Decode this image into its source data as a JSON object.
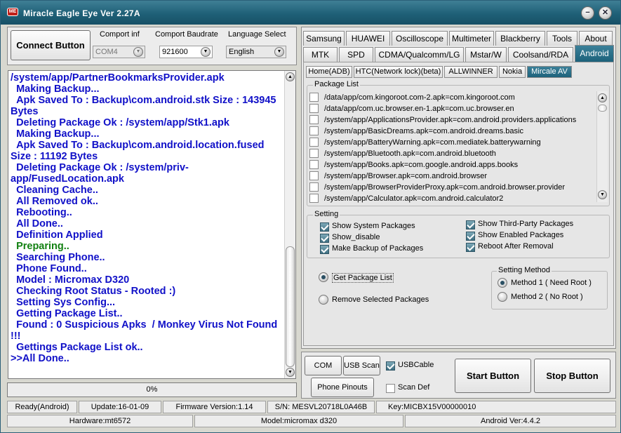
{
  "window": {
    "title": "Miracle Eagle Eye  Ver 2.27A",
    "icon_text": "ME",
    "minimize_icon": "−",
    "close_icon": "✕"
  },
  "connect": {
    "button": "Connect Button",
    "port_label": "Comport inf",
    "port_value": "COM4",
    "baud_label": "Comport Baudrate",
    "baud_value": "921600",
    "lang_label": "Language Select",
    "lang_value": "English"
  },
  "log": {
    "lines": [
      {
        "text": "/system/app/PartnerBookmarksProvider.apk",
        "color": "#1010c8"
      },
      {
        "text": "  Making Backup...",
        "color": "#1010c8"
      },
      {
        "text": "  Apk Saved To : Backup\\com.android.stk Size : 143945 Bytes",
        "color": "#1010c8"
      },
      {
        "text": "  Deleting Package Ok : /system/app/Stk1.apk",
        "color": "#1010c8"
      },
      {
        "text": "  Making Backup...",
        "color": "#1010c8"
      },
      {
        "text": "  Apk Saved To : Backup\\com.android.location.fused Size : 11192 Bytes",
        "color": "#1010c8"
      },
      {
        "text": "  Deleting Package Ok : /system/priv-app/FusedLocation.apk",
        "color": "#1010c8"
      },
      {
        "text": "  Cleaning Cache..",
        "color": "#1010c8"
      },
      {
        "text": "  All Removed ok..",
        "color": "#1010c8"
      },
      {
        "text": "  Rebooting..",
        "color": "#1010c8"
      },
      {
        "text": "  All Done..",
        "color": "#1010c8"
      },
      {
        "text": "  Definition Applied",
        "color": "#1010c8"
      },
      {
        "text": "  Preparing..",
        "color": "#118011"
      },
      {
        "text": "  Searching Phone..",
        "color": "#1010c8"
      },
      {
        "text": "  Phone Found..",
        "color": "#1010c8"
      },
      {
        "text": "  Model : Micromax D320",
        "color": "#1010c8"
      },
      {
        "text": "  Checking Root Status - Rooted :)",
        "color": "#1010c8"
      },
      {
        "text": "  Setting Sys Config...",
        "color": "#1010c8"
      },
      {
        "text": "  Getting Package List..",
        "color": "#1010c8"
      },
      {
        "text": "  Found : 0 Suspicious Apks  / Monkey Virus Not Found !!!",
        "color": "#1010c8"
      },
      {
        "text": "  Gettings Package List ok..",
        "color": "#1010c8"
      },
      {
        "text": ">>All Done..",
        "color": "#1010c8"
      }
    ]
  },
  "progress": {
    "value": 0,
    "label": "0%"
  },
  "tabs_row1": [
    "Samsung",
    "HUAWEI",
    "Oscilloscope",
    "Multimeter",
    "Blackberry",
    "Tools",
    "About"
  ],
  "tabs_row2": [
    "MTK",
    "SPD",
    "CDMA/Qualcomm/LG",
    "Mstar/W",
    "Coolsand/RDA",
    "Android"
  ],
  "active_tab": "Android",
  "subtabs": [
    "Home(ADB)",
    "HTC(Network lock)(beta)",
    "ALLWINNER",
    "Nokia",
    "Mircale AV"
  ],
  "active_subtab": "Mircale AV",
  "package_list": {
    "title": "Package List",
    "items": [
      "/data/app/com.kingoroot.com-2.apk=com.kingoroot.com",
      "/data/app/com.uc.browser.en-1.apk=com.uc.browser.en",
      "/system/app/ApplicationsProvider.apk=com.android.providers.applications",
      "/system/app/BasicDreams.apk=com.android.dreams.basic",
      "/system/app/BatteryWarning.apk=com.mediatek.batterywarning",
      "/system/app/Bluetooth.apk=com.android.bluetooth",
      "/system/app/Books.apk=com.google.android.apps.books",
      "/system/app/Browser.apk=com.android.browser",
      "/system/app/BrowserProviderProxy.apk=com.android.browser.provider",
      "/system/app/Calculator.apk=com.android.calculator2"
    ]
  },
  "setting": {
    "title": "Setting",
    "options": [
      {
        "label": "Show System Packages",
        "checked": true
      },
      {
        "label": "Show_disable",
        "checked": true
      },
      {
        "label": "Make Backup of Packages",
        "checked": true
      },
      {
        "label": "Show Third-Party Packages",
        "checked": true
      },
      {
        "label": "Show Enabled Packages",
        "checked": true
      },
      {
        "label": "Reboot After Removal",
        "checked": true
      }
    ]
  },
  "actions": {
    "get_list": "Get Package List",
    "remove": "Remove Selected Packages",
    "selected": "get_list"
  },
  "method": {
    "title": "Setting Method",
    "option1": "Method 1 ( Need Root )",
    "option2": "Method 2 ( No Root )",
    "selected": "option1"
  },
  "bottom": {
    "com_scan": "COM Scan",
    "usb_scan": "USB Scan",
    "usb_cable": "USBCable",
    "usb_cable_checked": true,
    "phone_pinouts": "Phone Pinouts",
    "scan_def": "Scan Def",
    "scan_def_checked": false,
    "start": "Start Button",
    "stop": "Stop Button"
  },
  "statusbar": {
    "ready": "Ready(Android)",
    "update": "Update:16-01-09",
    "firmware": "Firmware Version:1.14",
    "sn": "S/N: MESVL20718L0A46B",
    "key": "Key:MICBX15V00000010",
    "hardware": "Hardware:mt6572",
    "model": "Model:micromax d320",
    "android": "Android Ver:4.4.2"
  },
  "icons": {
    "scroll_up": "▲",
    "scroll_down": "▼",
    "combo_arrow": "▼"
  },
  "colors": {
    "accent": "#1d627b",
    "log_text": "#1010c8",
    "log_green": "#118011"
  }
}
